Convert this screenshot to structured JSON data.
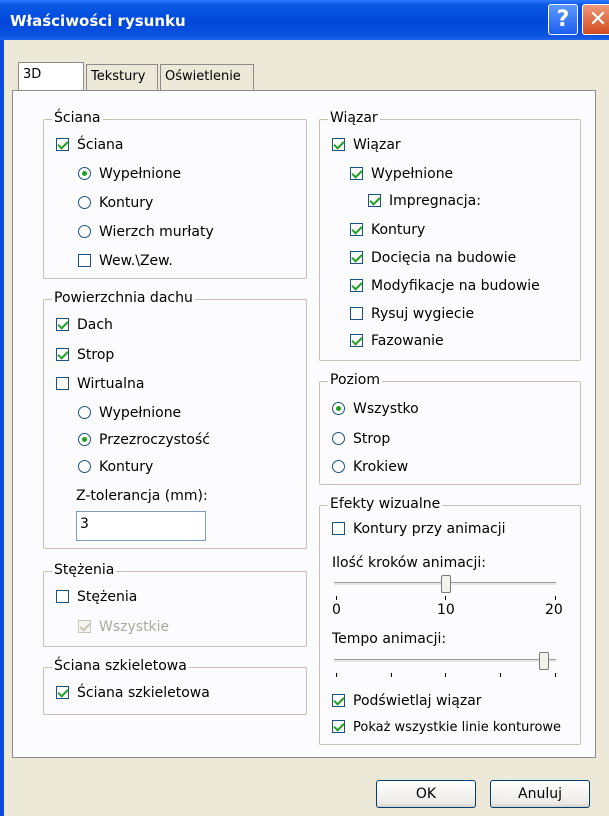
{
  "window": {
    "title": "Właściwości rysunku"
  },
  "tabs": [
    {
      "label": "3D",
      "active": true
    },
    {
      "label": "Tekstury",
      "active": false
    },
    {
      "label": "Oświetlenie",
      "active": false
    }
  ],
  "sciana": {
    "legend": "Ściana",
    "sciana_label": "Ściana",
    "wypelnione_label": "Wypełnione",
    "kontury_label": "Kontury",
    "wierzch_label": "Wierzch murłaty",
    "wewzew_label": "Wew.\\Zew."
  },
  "powierzchnia": {
    "legend": "Powierzchnia dachu",
    "dach_label": "Dach",
    "strop_label": "Strop",
    "wirtualna_label": "Wirtualna",
    "wypelnione_label": "Wypełnione",
    "przezroczystosc_label": "Przezroczystość",
    "kontury_label": "Kontury",
    "ztol_label": "Z-tolerancja (mm):",
    "ztol_value": "3"
  },
  "stezenia": {
    "legend": "Stężenia",
    "stezenia_label": "Stężenia",
    "wszystkie_label": "Wszystkie"
  },
  "szkielet": {
    "legend": "Ściana szkieletowa",
    "label": "Ściana szkieletowa"
  },
  "wiazar": {
    "legend": "Wiązar",
    "wiazar_label": "Wiązar",
    "wypelnione_label": "Wypełnione",
    "impregnacja_label": "Impregnacja:",
    "kontury_label": "Kontury",
    "dociecia_label": "Docięcia na budowie",
    "modyfikacje_label": "Modyfikacje na budowie",
    "wygiecie_label": "Rysuj wygiecie",
    "fazowanie_label": "Fazowanie"
  },
  "poziom": {
    "legend": "Poziom",
    "wszystko_label": "Wszystko",
    "strop_label": "Strop",
    "krokiew_label": "Krokiew"
  },
  "efekty": {
    "legend": "Efekty wizualne",
    "kontury_anim_label": "Kontury przy animacji",
    "kroki_label": "Ilość kroków animacji:",
    "kroki_value": 10,
    "kroki_min": "0",
    "kroki_mid": "10",
    "kroki_max": "20",
    "tempo_label": "Tempo animacji:",
    "tempo_fraction": 0.95,
    "podswietlaj_label": "Podświetlaj wiązar",
    "pokaz_label": "Pokaż wszystkie linie konturowe"
  },
  "buttons": {
    "ok": "OK",
    "cancel": "Anuluj"
  }
}
